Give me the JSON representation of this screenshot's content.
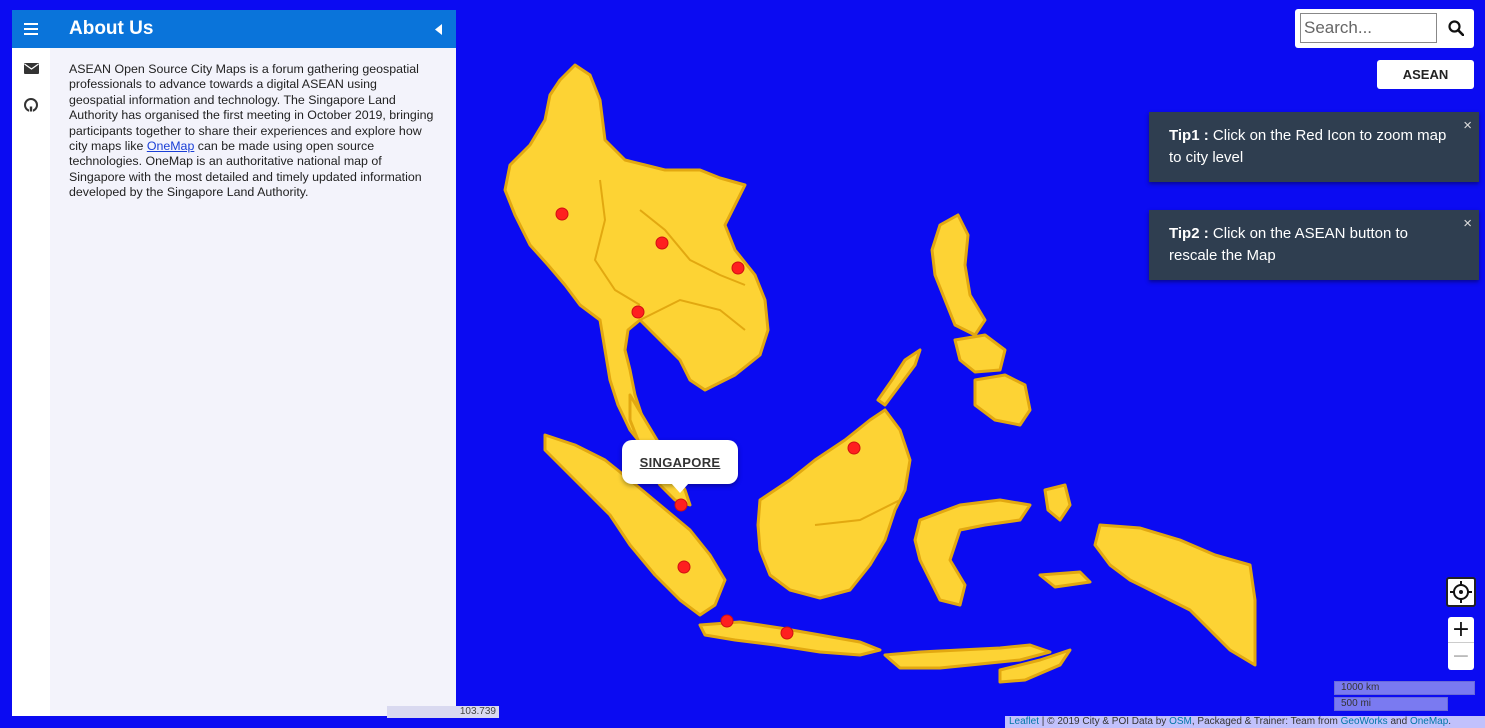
{
  "sidebar": {
    "title": "About Us",
    "body_before_link": "ASEAN Open Source City Maps is a forum gathering geospatial professionals to advance towards a digital ASEAN using geospatial information and technology. The Singapore Land Authority has organised the first meeting in October 2019, bringing participants together to share their experiences and explore how city maps like ",
    "link_text": "OneMap",
    "body_after_link": " can be made using open source technologies. OneMap is an authoritative national map of Singapore with the most detailed and timely updated information developed by the Singapore Land Authority.",
    "tabs": [
      "menu-icon",
      "envelope-icon",
      "github-icon"
    ]
  },
  "search": {
    "placeholder": "Search..."
  },
  "asean_button": "ASEAN",
  "tips": [
    {
      "label": "Tip1 :",
      "text": " Click on the Red Icon to zoom map to city level",
      "close": "×"
    },
    {
      "label": "Tip2 :",
      "text": " Click on the ASEAN button to rescale the Map",
      "close": "×"
    }
  ],
  "popup": {
    "label": "SINGAPORE"
  },
  "zoom": {
    "in": "+",
    "out": "−"
  },
  "scale": {
    "km": "1000 km",
    "mi": "500 mi"
  },
  "coords": "103.739",
  "attribution": {
    "leaflet": "Leaflet",
    "text1": " | © 2019 City & POI Data by ",
    "osm": "OSM",
    "text2": ", Packaged & Trainer: Team from ",
    "geoworks": "GeoWorks",
    "text3": " and ",
    "onemap": "OneMap",
    "text4": "."
  },
  "colors": {
    "sea": "#0b0bf2",
    "land": "#fdd334",
    "border": "#e0a80f",
    "marker": "#ff1f1f",
    "sidebar_header": "#0a74da",
    "tip_bg": "#2f3e50"
  },
  "markers": [
    "city-marker"
  ]
}
